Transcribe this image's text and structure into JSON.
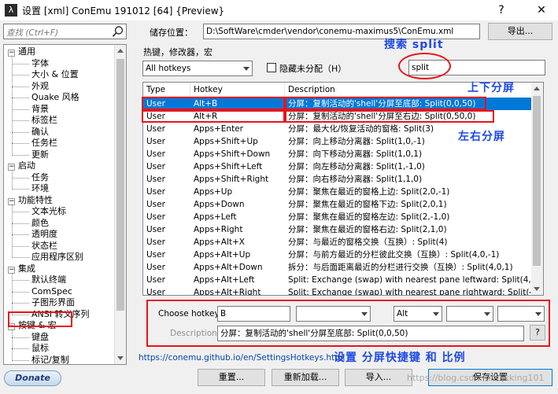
{
  "window": {
    "title": "设置 [xml] ConEmu 191012 [64] {Preview}",
    "help_glyph": "?",
    "close_glyph": "✕"
  },
  "sidebar": {
    "search_placeholder": "查找 (Ctrl+F)",
    "tree": [
      {
        "label": "通用",
        "level": 0,
        "expander": "−"
      },
      {
        "label": "字体",
        "level": 1
      },
      {
        "label": "大小 & 位置",
        "level": 1
      },
      {
        "label": "外观",
        "level": 1
      },
      {
        "label": "Quake 风格",
        "level": 1
      },
      {
        "label": "背景",
        "level": 1
      },
      {
        "label": "标签栏",
        "level": 1
      },
      {
        "label": "确认",
        "level": 1
      },
      {
        "label": "任务栏",
        "level": 1
      },
      {
        "label": "更新",
        "level": 1
      },
      {
        "label": "启动",
        "level": 0,
        "expander": "−"
      },
      {
        "label": "任务",
        "level": 1
      },
      {
        "label": "环境",
        "level": 1
      },
      {
        "label": "功能特性",
        "level": 0,
        "expander": "−"
      },
      {
        "label": "文本光标",
        "level": 1
      },
      {
        "label": "颜色",
        "level": 1
      },
      {
        "label": "透明度",
        "level": 1
      },
      {
        "label": "状态栏",
        "level": 1
      },
      {
        "label": "应用程序区别",
        "level": 1
      },
      {
        "label": "集成",
        "level": 0,
        "expander": "−"
      },
      {
        "label": "默认终端",
        "level": 1
      },
      {
        "label": "ComSpec",
        "level": 1
      },
      {
        "label": "子图形界面",
        "level": 1
      },
      {
        "label": "ANSI 转义序列",
        "level": 1
      },
      {
        "label": "按键 & 宏",
        "level": 0,
        "expander": "−"
      },
      {
        "label": "键盘",
        "level": 1
      },
      {
        "label": "鼠标",
        "level": 1
      },
      {
        "label": "标记/复制",
        "level": 1
      }
    ]
  },
  "storage": {
    "label": "储存位置：",
    "path": "D:\\SoftWare\\cmder\\vendor\\conemu-maximus5\\ConEmu.xml",
    "export_button": "导出..."
  },
  "hotkeys": {
    "section_label": "热键，修改器，宏",
    "filter_value": "All hotkeys",
    "hide_unassigned_label": "隐藏未分配（H）",
    "search_value": "split",
    "columns": [
      "Type",
      "Hotkey",
      "Description"
    ],
    "rows": [
      {
        "type": "User",
        "hotkey": "Alt+B",
        "description": "分屏：复制活动的'shell'分屏至底部: Split(0,0,50)",
        "selected": true
      },
      {
        "type": "User",
        "hotkey": "Alt+R",
        "description": "分屏：复制活动的'shell'分屏至右边: Split(0,50,0)"
      },
      {
        "type": "User",
        "hotkey": "Apps+Enter",
        "description": "分屏：最大化/恢复活动的窗格: Split(3)"
      },
      {
        "type": "User",
        "hotkey": "Apps+Shift+Up",
        "description": "分屏：向上移动分离器: Split(1,0,-1)"
      },
      {
        "type": "User",
        "hotkey": "Apps+Shift+Down",
        "description": "分屏：向下移动分离器: Split(1,0,1)"
      },
      {
        "type": "User",
        "hotkey": "Apps+Shift+Left",
        "description": "分屏：向左移动分离器: Split(1,-1,0)"
      },
      {
        "type": "User",
        "hotkey": "Apps+Shift+Right",
        "description": "分屏：向右移动分离器: Split(1,1,0)"
      },
      {
        "type": "User",
        "hotkey": "Apps+Up",
        "description": "分屏：聚焦在最近的窗格上边: Split(2,0,-1)"
      },
      {
        "type": "User",
        "hotkey": "Apps+Down",
        "description": "分屏：聚焦在最近的窗格下边: Split(2,0,1)"
      },
      {
        "type": "User",
        "hotkey": "Apps+Left",
        "description": "分屏：聚焦在最近的窗格左边: Split(2,-1,0)"
      },
      {
        "type": "User",
        "hotkey": "Apps+Right",
        "description": "分屏：聚焦在最近的窗格右边: Split(2,1,0)"
      },
      {
        "type": "User",
        "hotkey": "Apps+Alt+X",
        "description": "分屏：与最近的窗格交换（互换）: Split(4)"
      },
      {
        "type": "User",
        "hotkey": "Apps+Alt+Up",
        "description": "分屏：与前方最近的分栏彼此交换（互换）: Split(4,0,-1)"
      },
      {
        "type": "User",
        "hotkey": "Apps+Alt+Down",
        "description": "拆分：与后面距离最近的分栏进行交换（互换）: Split(4,0,1)"
      },
      {
        "type": "User",
        "hotkey": "Apps+Alt+Left",
        "description": "Split: Exchange (swap) with nearest pane leftward: Split(4,-..."
      },
      {
        "type": "User",
        "hotkey": "Apps+Alt+Right",
        "description": "Split: Exchange (swap) with nearest pane rightward: Split(4,..."
      }
    ],
    "choose_label": "Choose hotkey:",
    "choose_value": "B",
    "modifier_value": "Alt",
    "description_label": "Description:",
    "description_value": "分屏：复制活动的'shell'分屏至底部: Split(0,0,50)",
    "description_help": "?"
  },
  "annotations": {
    "search_split": "搜索  split",
    "up_down": "上下分屏",
    "left_right": "左右分屏",
    "settings": "设置    分屏快捷键    和    比例",
    "color": "#1e49e6"
  },
  "footer": {
    "link": "https://conemu.github.io/en/SettingsHotkeys.html",
    "donate": "Donate",
    "reset": "重置...",
    "reload": "重新加载...",
    "import": "导入...",
    "save": "保存设置"
  },
  "watermark": "https://blog.csdn.net/ijkking101"
}
